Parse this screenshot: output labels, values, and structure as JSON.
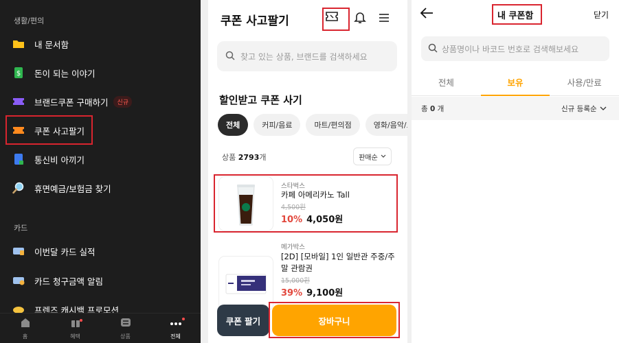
{
  "panel_menu": {
    "section_life": "생활/편의",
    "items": [
      {
        "label": "내 문서함",
        "icon": "folder-icon"
      },
      {
        "label": "돈이 되는 이야기",
        "icon": "money-note-icon"
      },
      {
        "label": "브랜드쿠폰 구매하기",
        "icon": "purple-coupon-icon",
        "badge": "신규"
      },
      {
        "label": "쿠폰 사고팔기",
        "icon": "orange-coupon-icon"
      },
      {
        "label": "통신비 아끼기",
        "icon": "phone-bill-icon"
      },
      {
        "label": "휴면예금/보험금 찾기",
        "icon": "magnifier-icon"
      }
    ],
    "section_card": "카드",
    "card_items": [
      {
        "label": "이번달 카드 실적",
        "icon": "card-chart-icon"
      },
      {
        "label": "카드 청구금액 알림",
        "icon": "card-bill-icon"
      },
      {
        "label": "프렌즈 캐시백 프로모션",
        "icon": "cashback-icon"
      }
    ],
    "bottom_nav": [
      {
        "label": "홈",
        "icon": "home-icon"
      },
      {
        "label": "혜택",
        "icon": "gift-icon"
      },
      {
        "label": "상품",
        "icon": "products-icon"
      },
      {
        "label": "전체",
        "icon": "more-dots-icon"
      }
    ],
    "colors": {
      "highlight": "#d9252f",
      "bg": "#1d1d1d"
    }
  },
  "panel_coupon": {
    "title": "쿠폰 사고팔기",
    "search_placeholder": "찾고 있는 상품, 브랜드를 검색하세요",
    "section_title": "할인받고 쿠폰 사기",
    "chips": [
      "전체",
      "커피/음료",
      "마트/편의점",
      "영화/음악/도서"
    ],
    "count_prefix": "상품",
    "count_value": "2793",
    "count_suffix": "개",
    "sort_label": "판매순",
    "products": [
      {
        "brand": "스타벅스",
        "name": "카페 아메리카노 Tall",
        "original_price": "4,500원",
        "discount": "10%",
        "price": "4,050원"
      },
      {
        "brand": "메가박스",
        "name": "[2D] [모바일] 1인 일반관 주중/주말 관람권",
        "original_price": "15,000원",
        "discount": "39%",
        "price": "9,100원"
      }
    ],
    "sell_button": "쿠폰 팔기",
    "cart_button": "장바구니",
    "colors": {
      "accent": "#ffa400",
      "discount": "#e2483d",
      "sell": "#2e3a47"
    }
  },
  "panel_mybox": {
    "title": "내 쿠폰함",
    "close": "닫기",
    "search_placeholder": "상품명이나 바코드 번호로 검색해보세요",
    "tabs": [
      "전체",
      "보유",
      "사용/만료"
    ],
    "active_tab": "보유",
    "total_prefix": "총",
    "total_value": "0",
    "total_suffix": "개",
    "sort_label": "신규 등록순"
  }
}
